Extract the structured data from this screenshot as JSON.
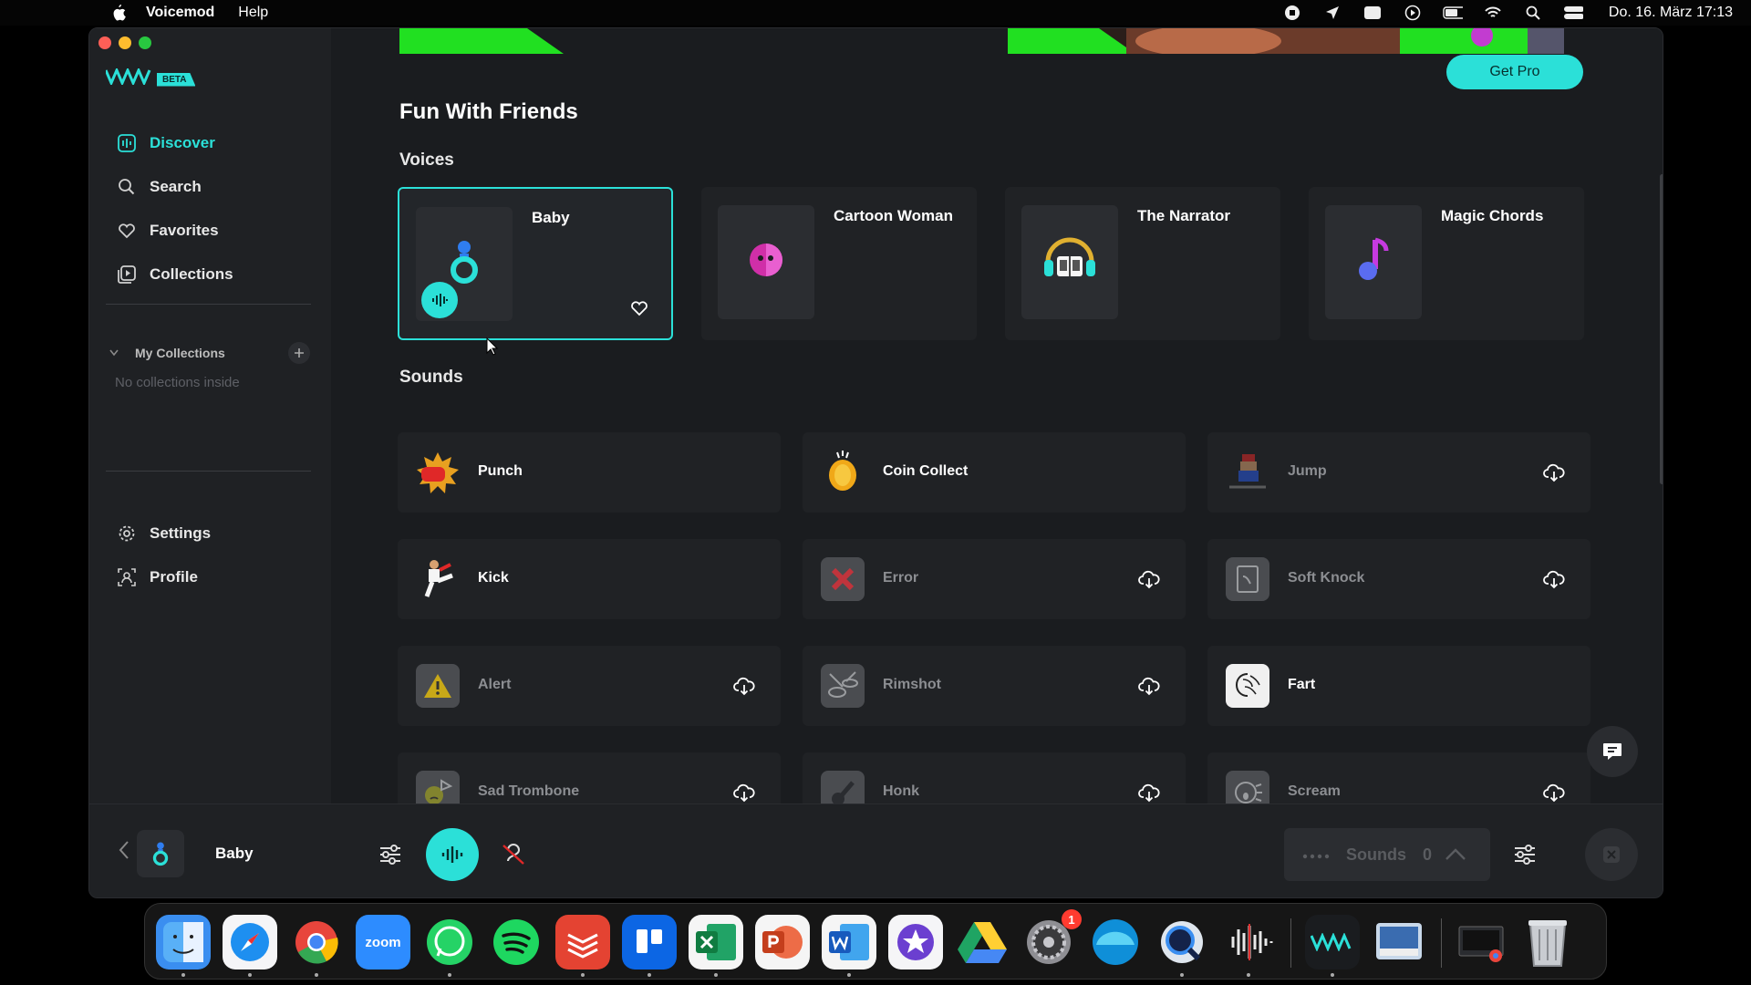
{
  "menubar": {
    "app_name": "Voicemod",
    "menu_items": [
      "Help"
    ],
    "clock": "Do. 16. März 17:13"
  },
  "colors": {
    "accent": "#2be0d8",
    "background": "#1a1c1f",
    "sidebar": "#1f2124",
    "banner_green": "#21e021",
    "get_pro": "#2be0d8"
  },
  "sidebar": {
    "beta_label": "BETA",
    "nav": [
      {
        "label": "Discover",
        "icon": "discover-icon",
        "active": true
      },
      {
        "label": "Search",
        "icon": "search-icon"
      },
      {
        "label": "Favorites",
        "icon": "heart-icon"
      },
      {
        "label": "Collections",
        "icon": "collections-icon"
      }
    ],
    "my_collections": {
      "label": "My Collections",
      "empty_text": "No collections inside"
    },
    "nav2": [
      {
        "label": "Settings",
        "icon": "gear-icon"
      },
      {
        "label": "Profile",
        "icon": "profile-icon"
      }
    ]
  },
  "main": {
    "get_pro_label": "Get Pro",
    "section_title": "Fun With Friends",
    "voices_title": "Voices",
    "sounds_title": "Sounds",
    "voices": [
      {
        "name": "Baby",
        "icon": "baby-icon",
        "selected": true
      },
      {
        "name": "Cartoon Woman",
        "icon": "cartoon-woman-icon"
      },
      {
        "name": "The Narrator",
        "icon": "narrator-icon"
      },
      {
        "name": "Magic Chords",
        "icon": "music-note-icon"
      }
    ],
    "sounds": [
      {
        "name": "Punch",
        "icon": "punch-icon",
        "downloaded": true
      },
      {
        "name": "Coin Collect",
        "icon": "coin-icon",
        "downloaded": true
      },
      {
        "name": "Jump",
        "icon": "jump-icon",
        "downloaded": false
      },
      {
        "name": "Kick",
        "icon": "kick-icon",
        "downloaded": true
      },
      {
        "name": "Error",
        "icon": "error-icon",
        "downloaded": false
      },
      {
        "name": "Soft Knock",
        "icon": "knock-icon",
        "downloaded": false
      },
      {
        "name": "Alert",
        "icon": "alert-icon",
        "downloaded": false
      },
      {
        "name": "Rimshot",
        "icon": "rimshot-icon",
        "downloaded": false
      },
      {
        "name": "Fart",
        "icon": "fart-icon",
        "downloaded": true
      },
      {
        "name": "Sad Trombone",
        "icon": "sad-trombone-icon",
        "downloaded": false
      },
      {
        "name": "Honk",
        "icon": "honk-icon",
        "downloaded": false
      },
      {
        "name": "Scream",
        "icon": "scream-icon",
        "downloaded": false
      }
    ]
  },
  "bottom_bar": {
    "current_voice": "Baby",
    "sounds_label": "Sounds",
    "sounds_count": "0"
  },
  "dock": {
    "items": [
      "Finder",
      "Safari",
      "Chrome",
      "zoom",
      "WhatsApp",
      "Spotify",
      "Todoist",
      "Trello",
      "Excel",
      "PowerPoint",
      "Word",
      "iMovie",
      "Google Drive",
      "System Preferences",
      "Edge",
      "QuickTime",
      "Voice Memos",
      "Voicemod",
      "Preview",
      "Downloads",
      "Trash"
    ],
    "zoom_label": "zoom",
    "settings_badge": "1"
  }
}
